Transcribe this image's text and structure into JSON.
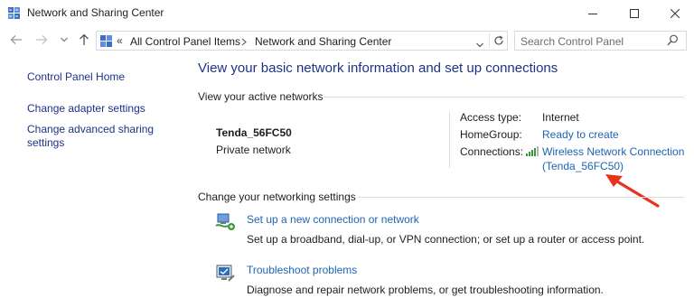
{
  "window": {
    "title": "Network and Sharing Center",
    "minimize_icon": "minimize-icon",
    "maximize_icon": "maximize-icon",
    "close_icon": "close-icon"
  },
  "addressbar": {
    "breadcrumb_prefix": "«",
    "crumbs": [
      "All Control Panel Items",
      "Network and Sharing Center"
    ],
    "search_placeholder": "Search Control Panel"
  },
  "sidebar": {
    "items": [
      {
        "label": "Control Panel Home"
      },
      {
        "label": "Change adapter settings"
      },
      {
        "label": "Change advanced sharing settings"
      }
    ]
  },
  "main": {
    "title": "View your basic network information and set up connections",
    "active_networks": {
      "heading": "View your active networks",
      "network_name": "Tenda_56FC50",
      "network_type": "Private network",
      "access_type_label": "Access type:",
      "access_type_value": "Internet",
      "homegroup_label": "HomeGroup:",
      "homegroup_value": "Ready to create",
      "connections_label": "Connections:",
      "connection_line1": "Wireless Network Connection",
      "connection_line2": "(Tenda_56FC50)"
    },
    "networking_settings": {
      "heading": "Change your networking settings",
      "tasks": [
        {
          "link": "Set up a new connection or network",
          "description": "Set up a broadband, dial-up, or VPN connection; or set up a router or access point."
        },
        {
          "link": "Troubleshoot problems",
          "description": "Diagnose and repair network problems, or get troubleshooting information."
        }
      ]
    }
  },
  "colors": {
    "heading_blue": "#1e3287",
    "link_blue": "#1e64b4",
    "annotation_arrow": "#e8321e"
  }
}
